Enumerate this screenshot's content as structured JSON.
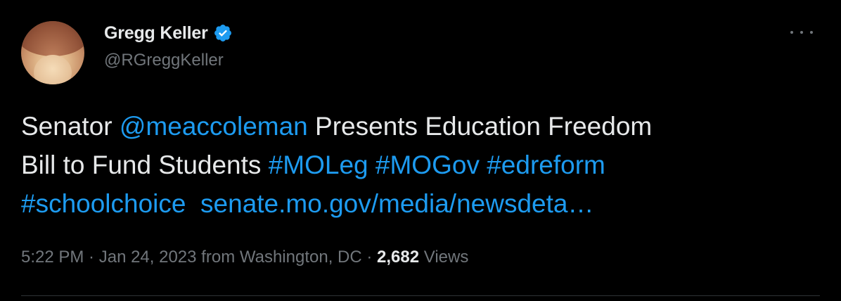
{
  "author": {
    "display_name": "Gregg Keller",
    "handle": "@RGreggKeller",
    "verified": true,
    "verified_icon": "verified-badge-icon",
    "avatar_icon": "profile-photo"
  },
  "tweet": {
    "segments": [
      {
        "text": "Senator ",
        "link": false
      },
      {
        "text": "@meaccoleman",
        "link": true
      },
      {
        "text": " Presents Education Freedom\nBill to Fund Students ",
        "link": false
      },
      {
        "text": "#MOLeg",
        "link": true
      },
      {
        "text": " ",
        "link": false
      },
      {
        "text": "#MOGov",
        "link": true
      },
      {
        "text": " ",
        "link": false
      },
      {
        "text": "#edreform",
        "link": true
      },
      {
        "text": "\n",
        "link": false
      },
      {
        "text": "#schoolchoice",
        "link": true
      },
      {
        "text": "  ",
        "link": false
      },
      {
        "text": "senate.mo.gov/media/newsdeta…",
        "link": true
      }
    ]
  },
  "meta": {
    "time": "5:22 PM",
    "separator": " · ",
    "date": "Jan 24, 2023",
    "source": " from Washington, DC",
    "views_count": "2,682",
    "views_label": " Views"
  },
  "menu": {
    "more_icon": "more-horizontal-icon"
  },
  "colors": {
    "background": "#000000",
    "text": "#e7e9ea",
    "secondary": "#71767b",
    "link": "#1d9bf0",
    "divider": "#2f3336"
  }
}
